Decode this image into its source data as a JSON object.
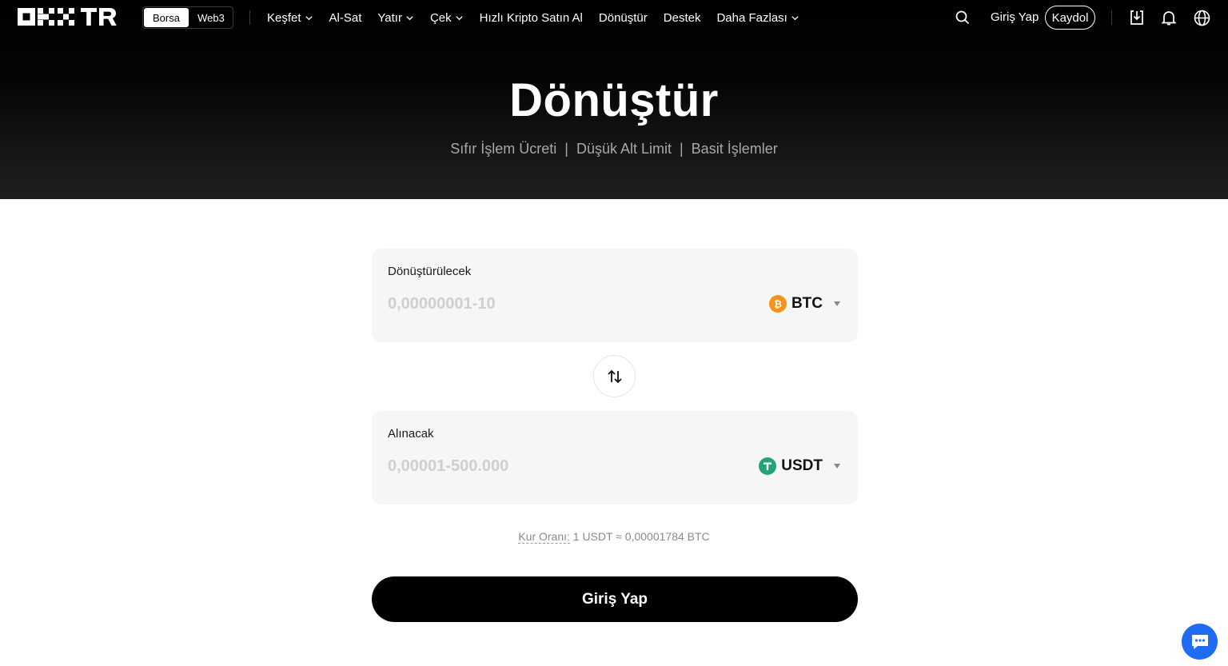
{
  "header": {
    "logo_text": "OKX TR",
    "switch": {
      "active": "Borsa",
      "inactive": "Web3"
    },
    "menu": [
      {
        "label": "Keşfet",
        "dropdown": true
      },
      {
        "label": "Al-Sat",
        "dropdown": false
      },
      {
        "label": "Yatır",
        "dropdown": true
      },
      {
        "label": "Çek",
        "dropdown": true
      },
      {
        "label": "Hızlı Kripto Satın Al",
        "dropdown": false
      },
      {
        "label": "Dönüştür",
        "dropdown": false
      },
      {
        "label": "Destek",
        "dropdown": false
      },
      {
        "label": "Daha Fazlası",
        "dropdown": true
      }
    ],
    "login_label": "Giriş Yap",
    "signup_label": "Kaydol",
    "icons": [
      "search-icon",
      "download-icon",
      "bell-icon",
      "globe-icon"
    ]
  },
  "hero": {
    "title": "Dönüştür",
    "subtitle": "Sıfır İşlem Ücreti  |  Düşük Alt Limit  |  Basit İşlemler"
  },
  "convert": {
    "from": {
      "label": "Dönüştürülecek",
      "placeholder": "0,00000001-10",
      "coin": "BTC",
      "coin_color": "#f7931a"
    },
    "to": {
      "label": "Alınacak",
      "placeholder": "0,00001-500.000",
      "coin": "USDT",
      "coin_color": "#26a17b"
    },
    "rate_label": "Kur Oranı:",
    "rate_value": " 1 USDT ≈ 0,00001784 BTC",
    "submit_label": "Giriş Yap"
  },
  "colors": {
    "hero_bg": "#000000",
    "cta_bg": "#000000",
    "chat_bg": "#1f6cf2"
  }
}
